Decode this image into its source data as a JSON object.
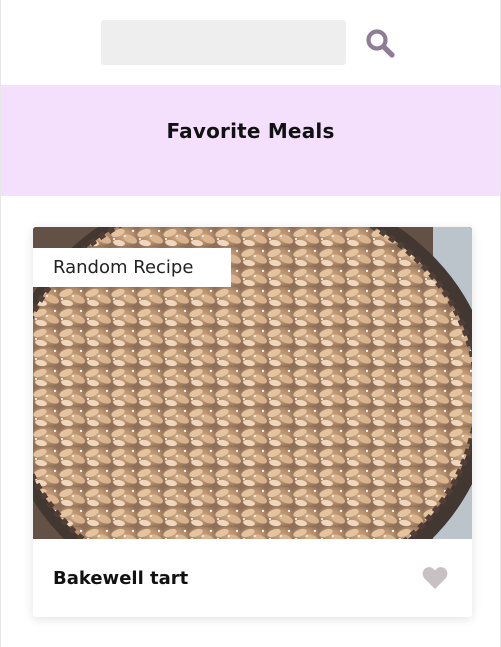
{
  "search": {
    "placeholder": "",
    "value": "",
    "icon": "search-icon"
  },
  "favorites": {
    "title": "Favorite Meals"
  },
  "random_meal": {
    "badge": "Random Recipe",
    "name": "Bakewell tart",
    "favorite_icon": "heart-icon",
    "favorited": false
  },
  "colors": {
    "banner_bg": "#f4e0fd",
    "search_bg": "#eeeeee",
    "search_icon": "#8e7d95",
    "heart_inactive": "#c9c0c4"
  }
}
